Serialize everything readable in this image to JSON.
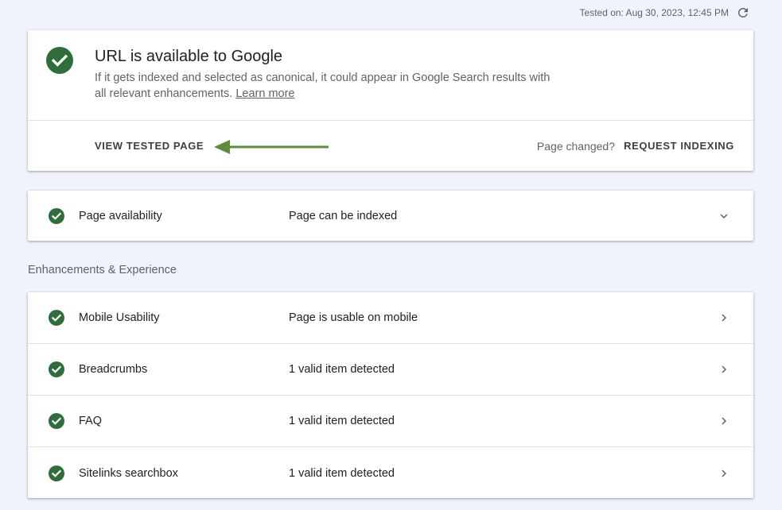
{
  "header": {
    "tested_on": "Tested on: Aug 30, 2023, 12:45 PM",
    "refresh_icon": "refresh-icon"
  },
  "status": {
    "icon": "check-circle-icon",
    "title": "URL is available to Google",
    "description": "If it gets indexed and selected as canonical, it could appear in Google Search results with all relevant enhancements.",
    "learn_more": "Learn more",
    "view_tested_page": "VIEW TESTED PAGE",
    "page_changed": "Page changed?",
    "request_indexing": "REQUEST INDEXING"
  },
  "availability": {
    "label": "Page availability",
    "value": "Page can be indexed",
    "icon": "check-circle-icon",
    "chevron": "chevron-down-icon"
  },
  "enhancements": {
    "heading": "Enhancements & Experience",
    "rows": [
      {
        "label": "Mobile Usability",
        "value": "Page is usable on mobile"
      },
      {
        "label": "Breadcrumbs",
        "value": "1 valid item detected"
      },
      {
        "label": "FAQ",
        "value": "1 valid item detected"
      },
      {
        "label": "Sitelinks searchbox",
        "value": "1 valid item detected"
      }
    ]
  },
  "colors": {
    "success_green": "#1e8e3e",
    "check_dark_green": "#2e6e3a",
    "arrow_green": "#5b8d3a",
    "background": "#f0f3fb"
  }
}
